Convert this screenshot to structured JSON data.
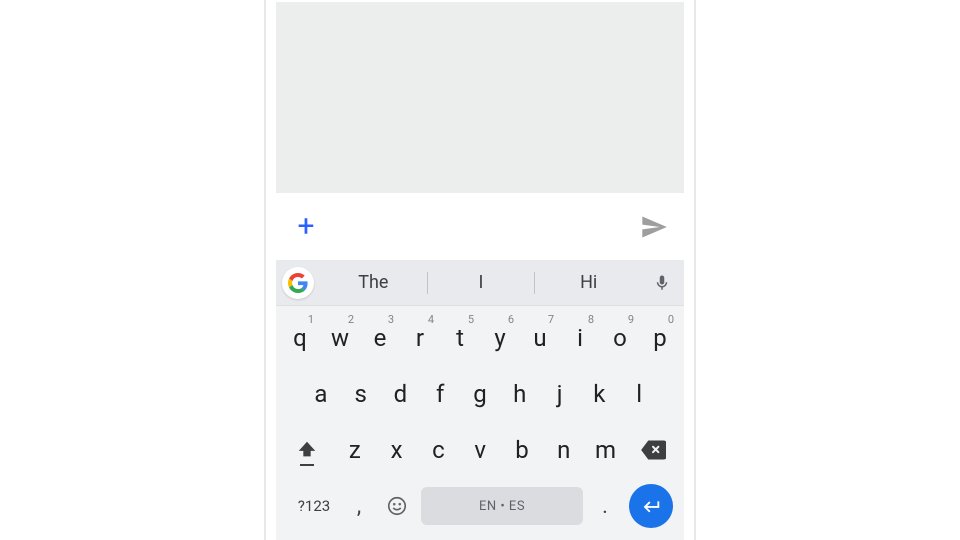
{
  "compose": {
    "plus_label": "+"
  },
  "suggestions": [
    "The",
    "I",
    "Hi"
  ],
  "keyboard": {
    "row1": [
      {
        "k": "q",
        "h": "1"
      },
      {
        "k": "w",
        "h": "2"
      },
      {
        "k": "e",
        "h": "3"
      },
      {
        "k": "r",
        "h": "4"
      },
      {
        "k": "t",
        "h": "5"
      },
      {
        "k": "y",
        "h": "6"
      },
      {
        "k": "u",
        "h": "7"
      },
      {
        "k": "i",
        "h": "8"
      },
      {
        "k": "o",
        "h": "9"
      },
      {
        "k": "p",
        "h": "0"
      }
    ],
    "row2": [
      "a",
      "s",
      "d",
      "f",
      "g",
      "h",
      "j",
      "k",
      "l"
    ],
    "row3": [
      "z",
      "x",
      "c",
      "v",
      "b",
      "n",
      "m"
    ],
    "symbols_label": "?123",
    "comma": ",",
    "period": ".",
    "space_label": "EN • ES"
  }
}
